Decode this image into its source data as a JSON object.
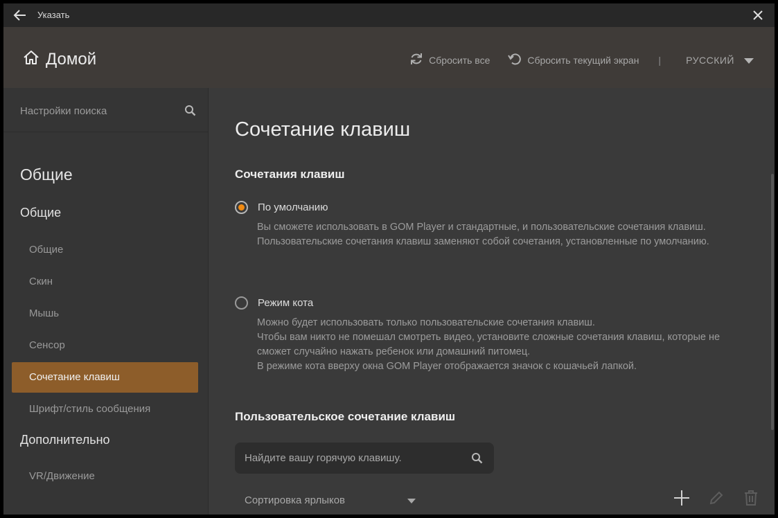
{
  "titlebar": {
    "title": "Указать"
  },
  "header": {
    "home_label": "Домой",
    "reset_all": "Сбросить все",
    "reset_current": "Сбросить текущий экран",
    "separator": "|",
    "language": "РУССКИЙ"
  },
  "sidebar": {
    "search_placeholder": "Настройки поиска",
    "category": "Общие",
    "group_general": "Общие",
    "items_general": [
      "Общие",
      "Скин",
      "Мышь",
      "Сенсор",
      "Сочетание клавиш",
      "Шрифт/стиль сообщения"
    ],
    "active_item": "Сочетание клавиш",
    "group_advanced": "Дополнительно",
    "items_advanced": [
      "VR/Движение"
    ]
  },
  "content": {
    "page_title": "Сочетание клавиш",
    "section_hotkeys": "Сочетания клавиш",
    "option_default": {
      "label": "По умолчанию",
      "selected": true,
      "desc": [
        "Вы сможете использовать в GOM Player и стандартные, и пользовательские сочетания клавиш.",
        "Пользовательские сочетания клавиш заменяют собой сочетания, установленные по умолчанию."
      ]
    },
    "option_cat": {
      "label": "Режим кота",
      "selected": false,
      "desc": [
        "Можно будет использовать только пользовательские сочетания клавиш.",
        "Чтобы вам никто не помешал смотреть видео, установите сложные сочетания клавиш, которые не сможет случайно нажать ребенок или домашний питомец.",
        "В режиме кота вверху окна GOM Player отображается значок с кошачьей лапкой."
      ]
    },
    "section_custom": "Пользовательское сочетание клавиш",
    "hotkey_search_placeholder": "Найдите вашу горячую клавишу.",
    "sort_label": "Сортировка ярлыков"
  },
  "colors": {
    "accent": "#f08a12",
    "active_item": "#8d5d2a",
    "background": "#3a3a3a",
    "header": "#3f3b38"
  }
}
